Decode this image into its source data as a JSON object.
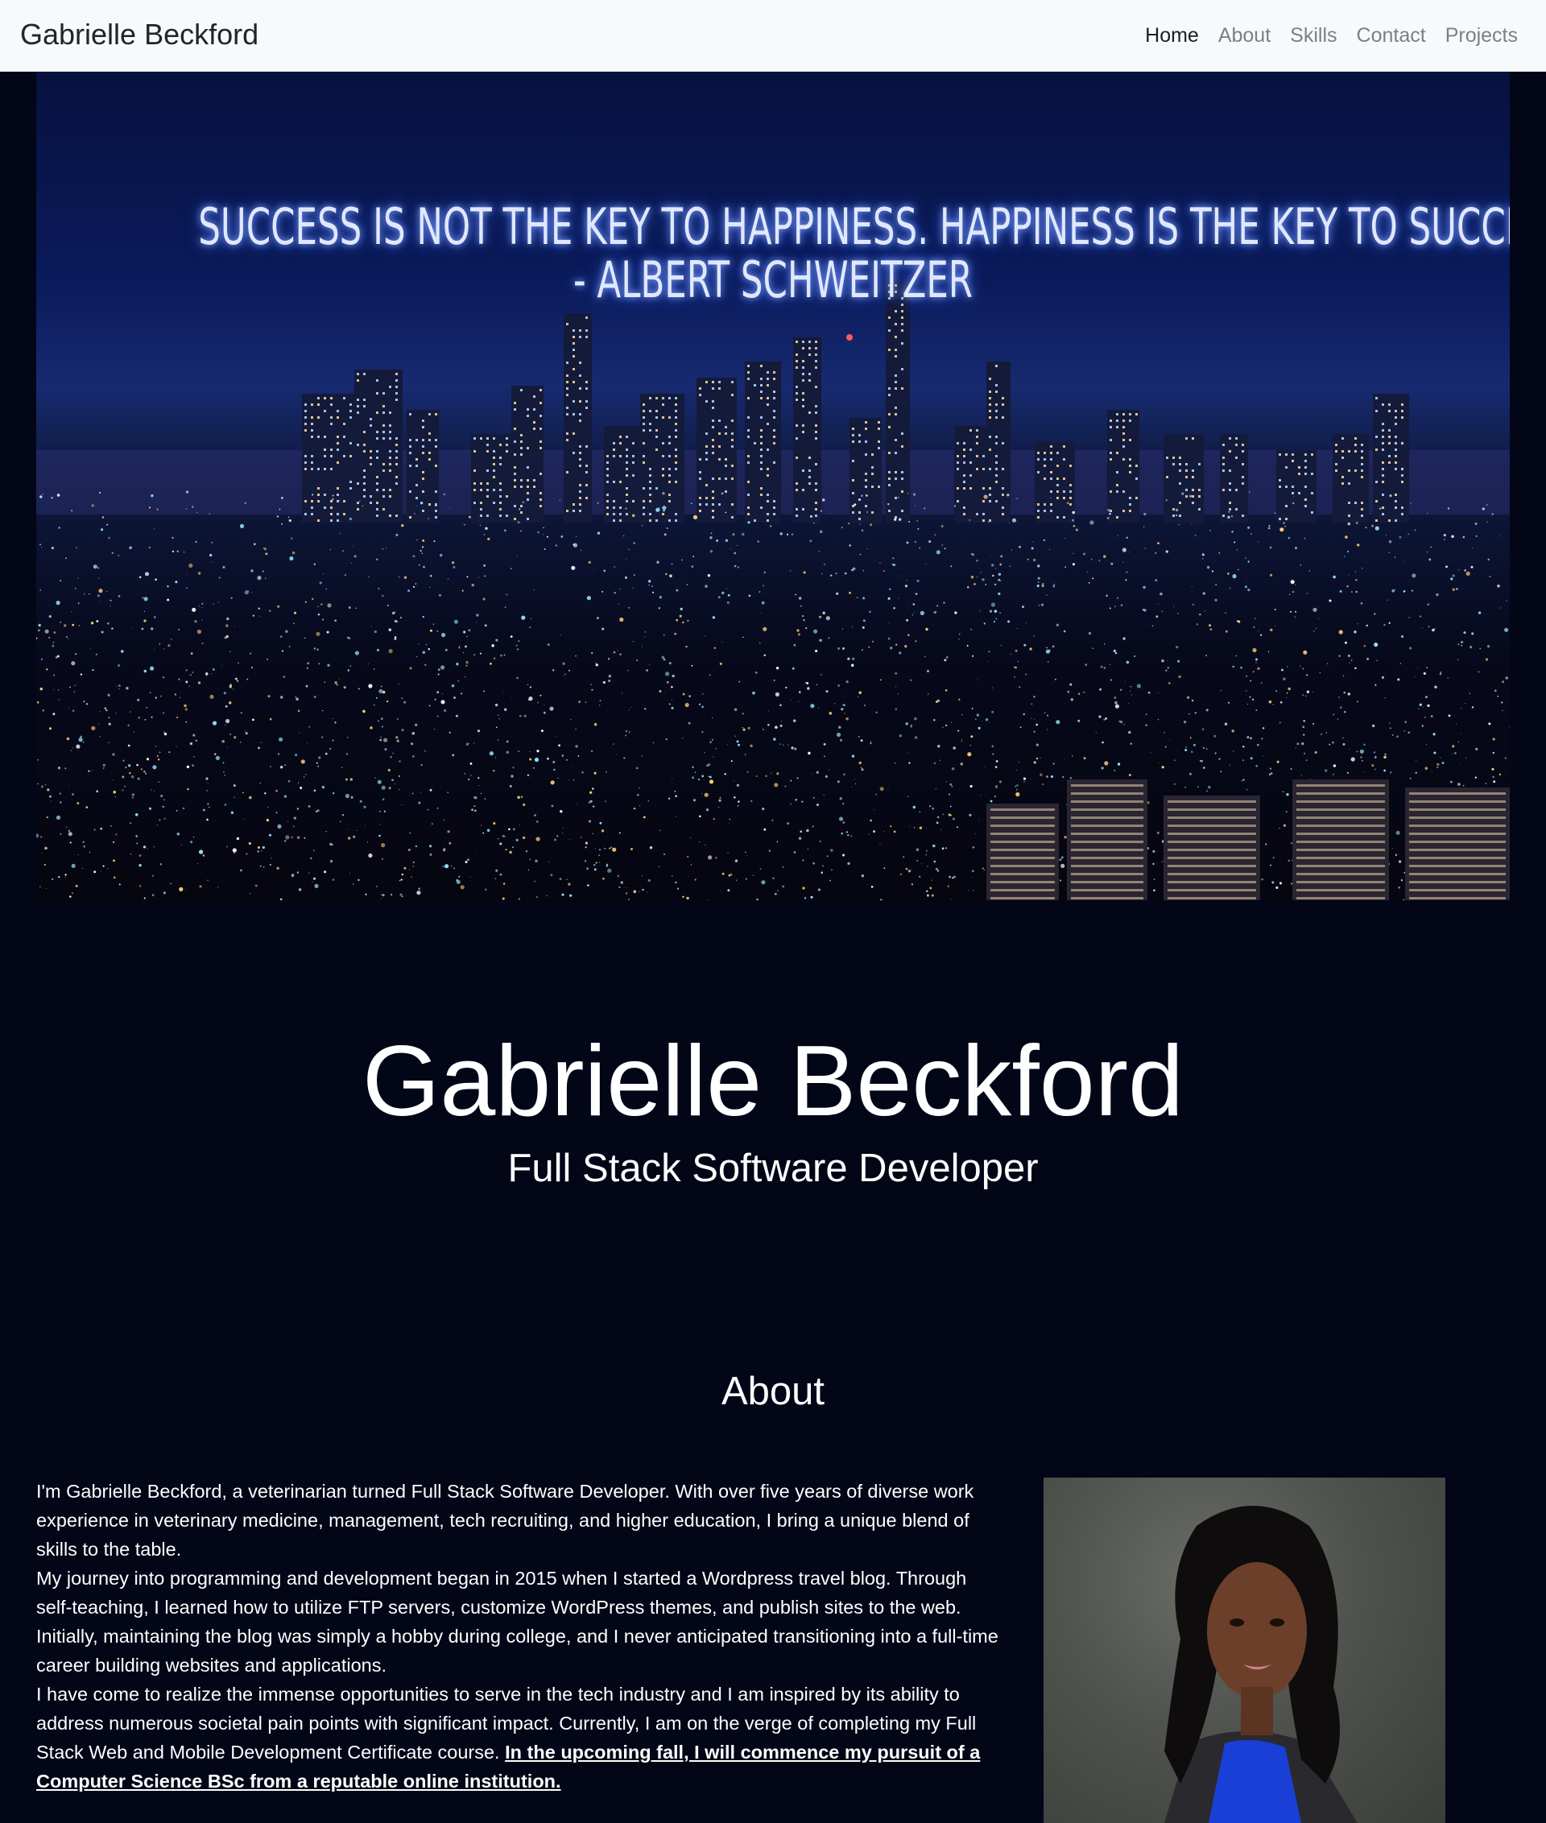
{
  "navbar": {
    "brand": "Gabrielle Beckford",
    "links": [
      "Home",
      "About",
      "Skills",
      "Contact",
      "Projects"
    ],
    "active": "Home"
  },
  "hero": {
    "quote_line1": "Success is not the key to happiness. Happiness is the key to success.",
    "quote_line2": "- Albert Schweitzer"
  },
  "intro": {
    "name": "Gabrielle Beckford",
    "role": "Full Stack Software Developer"
  },
  "about": {
    "heading": "About",
    "p1": "I'm Gabrielle Beckford, a veterinarian turned Full Stack Software Developer. With over five years of diverse work experience in veterinary medicine, management, tech recruiting, and higher education, I bring a unique blend of skills to the table.",
    "p2": "My journey into programming and development began in 2015 when I started a Wordpress travel blog. Through self-teaching, I learned how to utilize FTP servers, customize WordPress themes, and publish sites to the web. Initially, maintaining the blog was simply a hobby during college, and I never anticipated transitioning into a full-time career building websites and applications.",
    "p3": "I have come to realize the immense opportunities to serve in the tech industry and I am inspired by its ability to address numerous societal pain points with significant impact. Currently, I am on the verge of completing my Full Stack Web and Mobile Development Certificate course.",
    "p3_link": "In the upcoming fall, I will commence my pursuit of a Computer Science BSc from a reputable online institution."
  },
  "colors": {
    "page_bg": "#020617",
    "navbar_bg": "#f8f9fa",
    "text": "#ffffff"
  }
}
